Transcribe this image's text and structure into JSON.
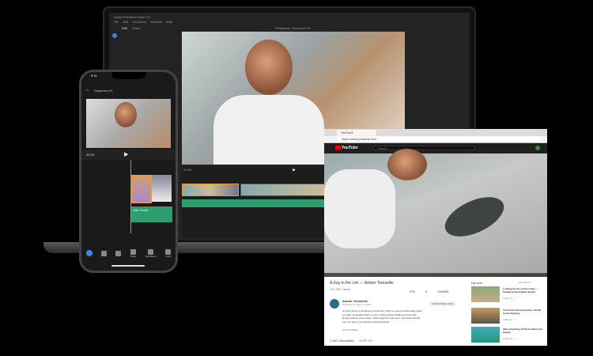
{
  "laptop": {
    "app_title": "Adobe Premiere Rush CC",
    "menu": [
      "File",
      "Edit",
      "Sequence",
      "Window",
      "Help"
    ],
    "tabs": [
      "Edit",
      "Share"
    ],
    "sequence_title": "Philippines: Sequence 01",
    "timecode": "00:08"
  },
  "phone": {
    "time": "9:41",
    "title": "Sequence 01",
    "timecode": "00:00",
    "audio_clip": "Wild Surfin",
    "tools": [
      "Titles",
      "Transitions",
      "Color"
    ]
  },
  "browser": {
    "tab_label": "YouTube",
    "url": "https://www.youtube.com",
    "search_placeholder": "Search",
    "logo": "YouTube",
    "video_title": "A Day in the Life — Amber Tomsellie",
    "views": "107,532 views",
    "likes": "17K",
    "dislikes": "9",
    "share": "SHARE",
    "channel": "Amber Tomsellie",
    "published": "Published on May 17, 2018",
    "subscribe": "SUBSCRIBED 300K",
    "description": "Go from shoot to shoptimum record time. Built on Leenyo functionality helps you take pro-quality video on your mobile devices. Editing is easy, with simple tools for color, audio, motion graphics and more. Just share directly from the app to your favorite social channels.",
    "show_more": "SHOW MORE",
    "comments": "1,341 Comments",
    "sort": "SORT BY",
    "up_next": "Up next",
    "autoplay": "AUTOPLAY",
    "suggestions": [
      {
        "title": "Looking for the perfect wave — Sunday at Huntington Beach",
        "meta": "Amber T. ✓"
      },
      {
        "title": "The Perfect Driving Guide: Pacific Coast Highway",
        "meta": "Amber T. ✓"
      },
      {
        "title": "Wave Boarding All Starts Maui and Hawaii",
        "meta": "Amber T. ✓"
      }
    ]
  }
}
